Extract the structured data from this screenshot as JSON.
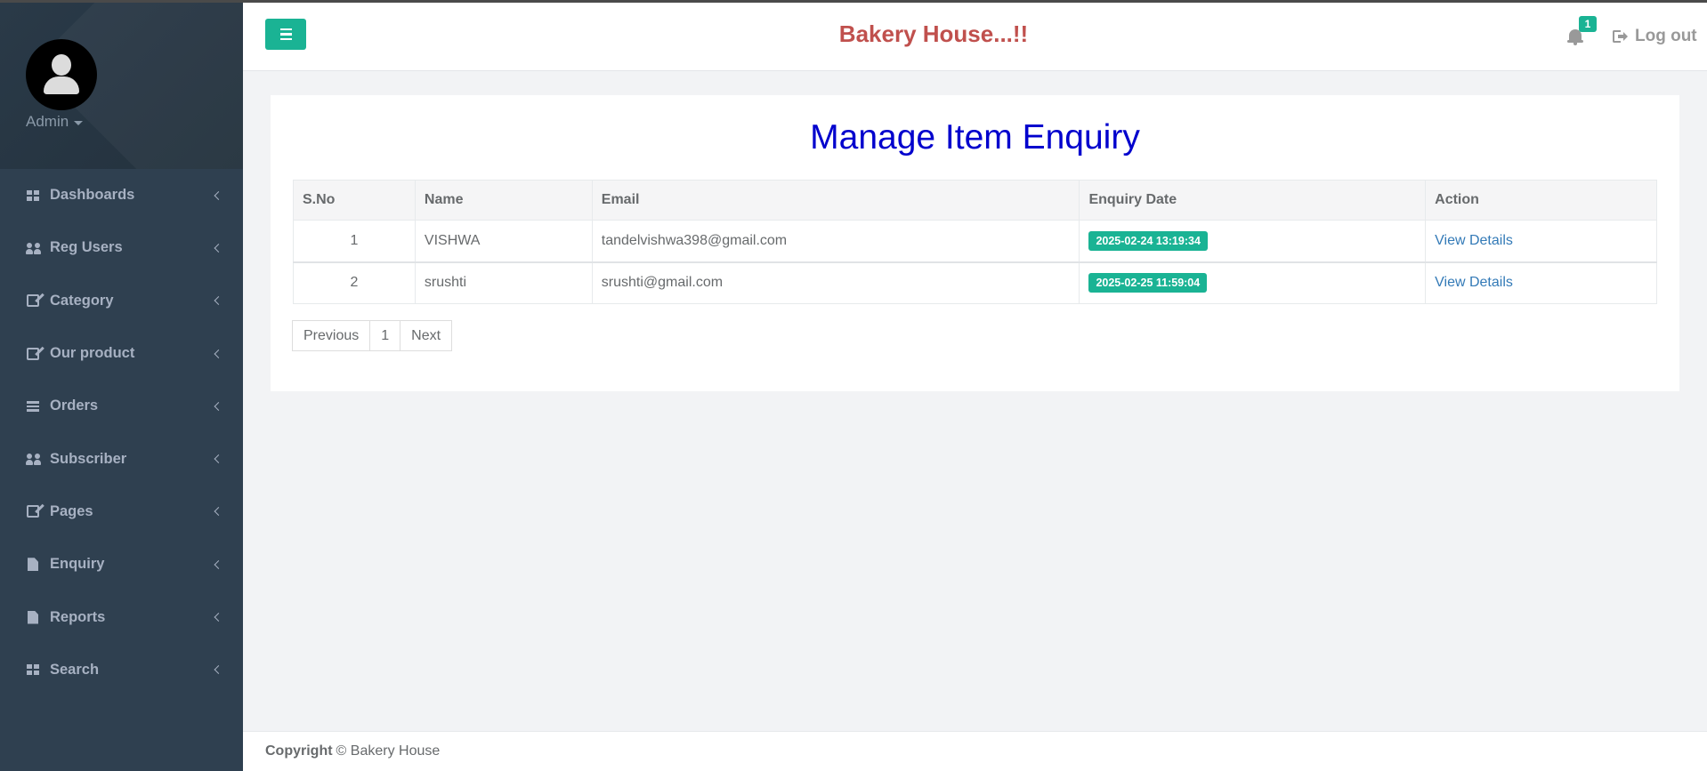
{
  "header": {
    "brand": "Bakery House...!!",
    "notification_count": "1",
    "logout_label": "Log out"
  },
  "sidebar": {
    "user": "Admin",
    "items": [
      {
        "label": "Dashboards",
        "icon": "grid-icon"
      },
      {
        "label": "Reg Users",
        "icon": "users-icon"
      },
      {
        "label": "Category",
        "icon": "edit-icon"
      },
      {
        "label": "Our product",
        "icon": "edit-icon"
      },
      {
        "label": "Orders",
        "icon": "list-icon"
      },
      {
        "label": "Subscriber",
        "icon": "users-icon"
      },
      {
        "label": "Pages",
        "icon": "edit-icon"
      },
      {
        "label": "Enquiry",
        "icon": "file-icon"
      },
      {
        "label": "Reports",
        "icon": "file-icon"
      },
      {
        "label": "Search",
        "icon": "grid-icon"
      }
    ]
  },
  "main": {
    "title": "Manage Item Enquiry",
    "table": {
      "columns": [
        "S.No",
        "Name",
        "Email",
        "Enquiry Date",
        "Action"
      ],
      "rows": [
        {
          "sno": "1",
          "name": "VISHWA",
          "email": "tandelvishwa398@gmail.com",
          "date": "2025-02-24 13:19:34",
          "action": "View Details"
        },
        {
          "sno": "2",
          "name": "srushti",
          "email": "srushti@gmail.com",
          "date": "2025-02-25 11:59:04",
          "action": "View Details"
        }
      ]
    },
    "pagination": {
      "previous": "Previous",
      "page": "1",
      "next": "Next"
    }
  },
  "footer": {
    "copyright_bold": "Copyright",
    "copyright_text": "© Bakery House"
  },
  "colors": {
    "accent": "#1ab394",
    "sidebar": "#2f4050",
    "brand": "#c0504d",
    "title": "#0000cd",
    "link": "#337ab7"
  }
}
